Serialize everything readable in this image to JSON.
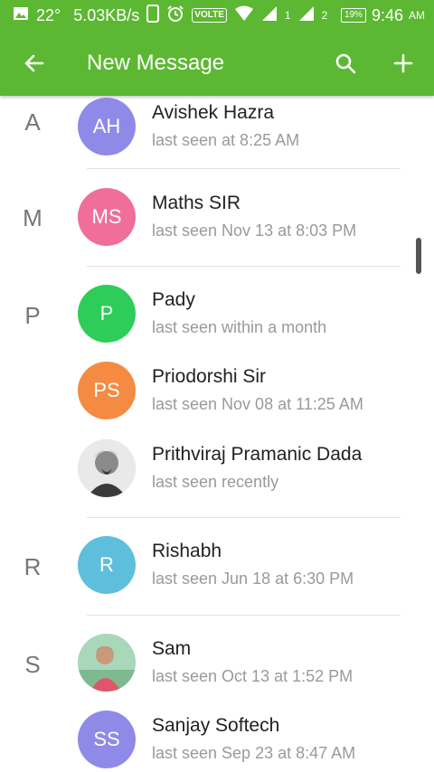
{
  "statusbar": {
    "temp": "22°",
    "speed": "5.03KB/s",
    "volte": "VOLTE",
    "sim1": "1",
    "sim2": "2",
    "battery": "19%",
    "time": "9:46",
    "ampm": "AM"
  },
  "appbar": {
    "title": "New Message"
  },
  "colors": {
    "primary": "#5cb832",
    "avatar_ah": "#8f89e8",
    "avatar_ms": "#ef6f9a",
    "avatar_p": "#2ecc58",
    "avatar_ps": "#f58a42",
    "avatar_r": "#5ebfdc",
    "avatar_ss": "#8f89e8"
  },
  "sections": {
    "a": {
      "letter": "A"
    },
    "m": {
      "letter": "M"
    },
    "p": {
      "letter": "P"
    },
    "r": {
      "letter": "R"
    },
    "s": {
      "letter": "S"
    }
  },
  "contacts": [
    {
      "initials": "AH",
      "name": "Avishek Hazra",
      "status": "last seen at 8:25 AM"
    },
    {
      "initials": "MS",
      "name": "Maths SIR",
      "status": "last seen Nov 13 at 8:03 PM"
    },
    {
      "initials": "P",
      "name": "Pady",
      "status": "last seen within a month"
    },
    {
      "initials": "PS",
      "name": "Priodorshi Sir",
      "status": "last seen Nov 08 at 11:25 AM"
    },
    {
      "initials": "",
      "name": "Prithviraj Pramanic Dada",
      "status": "last seen recently"
    },
    {
      "initials": "R",
      "name": "Rishabh",
      "status": "last seen Jun 18 at 6:30 PM"
    },
    {
      "initials": "",
      "name": "Sam",
      "status": "last seen Oct 13 at 1:52 PM"
    },
    {
      "initials": "SS",
      "name": "Sanjay Softech",
      "status": "last seen Sep 23 at 8:47 AM"
    }
  ]
}
